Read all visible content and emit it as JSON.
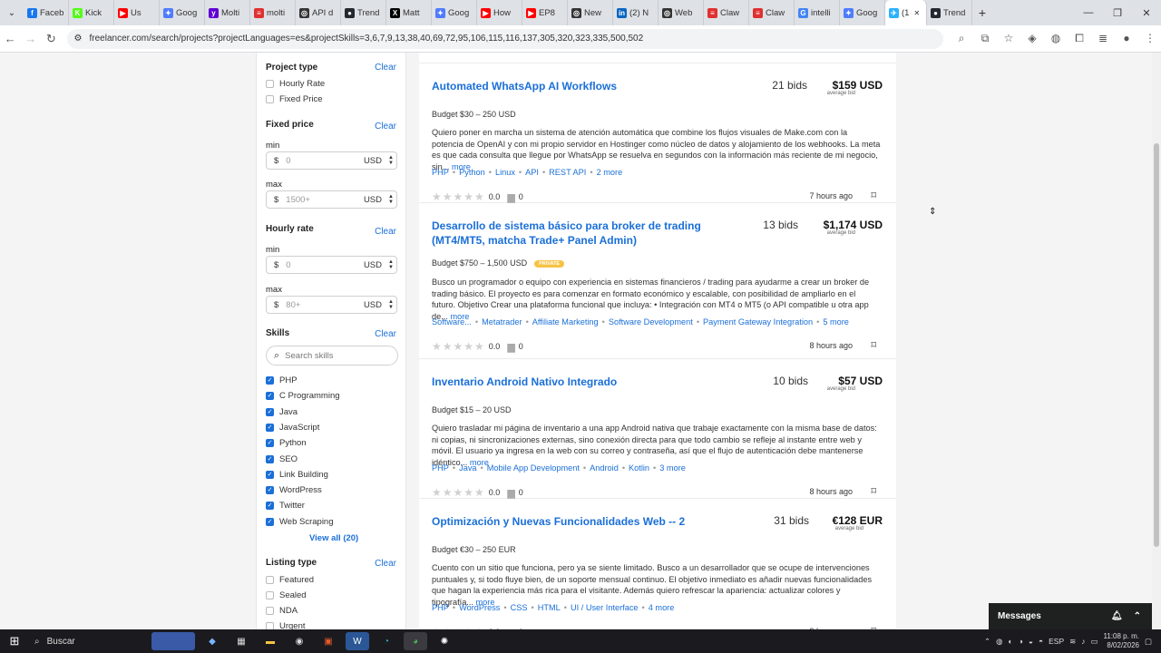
{
  "browser": {
    "tabs": [
      {
        "label": "Faceb",
        "icon": "facebook-icon",
        "color": "#1877f2",
        "glyph": "f"
      },
      {
        "label": "Kick",
        "icon": "kick-icon",
        "color": "#53fc18",
        "glyph": "K"
      },
      {
        "label": "Us",
        "icon": "youtube-icon",
        "color": "#ff0000",
        "glyph": "▶"
      },
      {
        "label": "Goog",
        "icon": "gemini-icon",
        "color": "#4f7cff",
        "glyph": "✦"
      },
      {
        "label": "Molti",
        "icon": "yahoo-icon",
        "color": "#6001d2",
        "glyph": "y"
      },
      {
        "label": "molti",
        "icon": "doc-icon",
        "color": "#e03030",
        "glyph": "≡"
      },
      {
        "label": "API d",
        "icon": "openai-icon",
        "color": "#333333",
        "glyph": "◎"
      },
      {
        "label": "Trend",
        "icon": "github-icon",
        "color": "#24292f",
        "glyph": "●"
      },
      {
        "label": "Matt",
        "icon": "x-icon",
        "color": "#000000",
        "glyph": "X"
      },
      {
        "label": "Goog",
        "icon": "gemini-icon",
        "color": "#4f7cff",
        "glyph": "✦"
      },
      {
        "label": "How",
        "icon": "youtube-icon",
        "color": "#ff0000",
        "glyph": "▶"
      },
      {
        "label": "EP8",
        "icon": "youtube-icon",
        "color": "#ff0000",
        "glyph": "▶"
      },
      {
        "label": "New",
        "icon": "openai-icon",
        "color": "#333333",
        "glyph": "◎"
      },
      {
        "label": "(2) N",
        "icon": "linkedin-icon",
        "color": "#0a66c2",
        "glyph": "in"
      },
      {
        "label": "Web",
        "icon": "openai-icon",
        "color": "#333333",
        "glyph": "◎"
      },
      {
        "label": "Claw",
        "icon": "doc-icon",
        "color": "#e03030",
        "glyph": "≡"
      },
      {
        "label": "Claw",
        "icon": "doc-icon",
        "color": "#e03030",
        "glyph": "≡"
      },
      {
        "label": "intelli",
        "icon": "google-icon",
        "color": "#4285f4",
        "glyph": "G"
      },
      {
        "label": "Goog",
        "icon": "gemini-icon",
        "color": "#4f7cff",
        "glyph": "✦"
      },
      {
        "label": "(1",
        "icon": "freelancer-icon",
        "color": "#29b2fe",
        "glyph": "✈",
        "active": true
      },
      {
        "label": "Trend",
        "icon": "github-icon",
        "color": "#24292f",
        "glyph": "●"
      }
    ],
    "url": "freelancer.com/search/projects?projectLanguages=es&projectSkills=3,6,7,9,13,38,40,69,72,95,106,115,116,137,305,320,323,335,500,502"
  },
  "sidebar": {
    "project_type": {
      "title": "Project type",
      "clear": "Clear",
      "options": [
        {
          "label": "Hourly Rate",
          "checked": false
        },
        {
          "label": "Fixed Price",
          "checked": false
        }
      ]
    },
    "fixed_price": {
      "title": "Fixed price",
      "clear": "Clear",
      "min_label": "min",
      "max_label": "max",
      "min_placeholder": "0",
      "max_placeholder": "1500+",
      "currency_symbol": "$",
      "currency": "USD"
    },
    "hourly_rate": {
      "title": "Hourly rate",
      "clear": "Clear",
      "min_label": "min",
      "max_label": "max",
      "min_placeholder": "0",
      "max_placeholder": "80+",
      "currency_symbol": "$",
      "currency": "USD"
    },
    "skills": {
      "title": "Skills",
      "clear": "Clear",
      "search_placeholder": "Search skills",
      "items": [
        {
          "label": "PHP",
          "checked": true
        },
        {
          "label": "C Programming",
          "checked": true
        },
        {
          "label": "Java",
          "checked": true
        },
        {
          "label": "JavaScript",
          "checked": true
        },
        {
          "label": "Python",
          "checked": true
        },
        {
          "label": "SEO",
          "checked": true
        },
        {
          "label": "Link Building",
          "checked": true
        },
        {
          "label": "WordPress",
          "checked": true
        },
        {
          "label": "Twitter",
          "checked": true
        },
        {
          "label": "Web Scraping",
          "checked": true
        }
      ],
      "view_all": "View all (20)"
    },
    "listing_type": {
      "title": "Listing type",
      "clear": "Clear",
      "options": [
        {
          "label": "Featured",
          "checked": false
        },
        {
          "label": "Sealed",
          "checked": false
        },
        {
          "label": "NDA",
          "checked": false
        },
        {
          "label": "Urgent",
          "checked": false
        }
      ]
    }
  },
  "projects": [
    {
      "title": "Automated WhatsApp AI Workflows",
      "bids": "21 bids",
      "price": "$159 USD",
      "price_note": "average bid",
      "budget": "Budget $30 – 250 USD",
      "private": "",
      "description": "Quiero poner en marcha un sistema de atención automática que combine los flujos visuales de Make.com con la potencia de OpenAI y con mi propio servidor en Hostinger como núcleo de datos y alojamiento de los webhooks. La meta es que cada consulta que llegue por WhatsApp se resuelva en segundos con la información más reciente de mi negocio, sin...",
      "more": "more",
      "tags": [
        "PHP",
        "Python",
        "Linux",
        "API",
        "REST API",
        "2 more"
      ],
      "rating": "0.0",
      "reviews": "0",
      "time": "7 hours ago"
    },
    {
      "title": "Desarrollo de sistema básico para broker de trading (MT4/MT5, matcha Trade+ Panel Admin)",
      "bids": "13 bids",
      "price": "$1,174 USD",
      "price_note": "average bid",
      "budget": "Budget $750 – 1,500 USD",
      "private": "PRIVATE",
      "description": "Busco un programador o equipo con experiencia en sistemas financieros / trading para ayudarme a crear un broker de trading básico. El proyecto es para comenzar en formato económico y escalable, con posibilidad de ampliarlo en el futuro. Objetivo Crear una plataforma funcional que incluya: • Integración con MT4 o MT5 (o API compatible u otra app de...",
      "more": "more",
      "tags": [
        "Software...",
        "Metatrader",
        "Affiliate Marketing",
        "Software Development",
        "Payment Gateway Integration",
        "5 more"
      ],
      "rating": "0.0",
      "reviews": "0",
      "time": "8 hours ago"
    },
    {
      "title": "Inventario Android Nativo Integrado",
      "bids": "10 bids",
      "price": "$57 USD",
      "price_note": "average bid",
      "budget": "Budget $15 – 20 USD",
      "private": "",
      "description": "Quiero trasladar mi página de inventario a una app Android nativa que trabaje exactamente con la misma base de datos: ni copias, ni sincronizaciones externas, sino conexión directa para que todo cambio se refleje al instante entre web y móvil. El usuario ya ingresa en la web con su correo y contraseña, así que el flujo de autenticación debe mantenerse idéntico...",
      "more": "more",
      "tags": [
        "PHP",
        "Java",
        "Mobile App Development",
        "Android",
        "Kotlin",
        "3 more"
      ],
      "rating": "0.0",
      "reviews": "0",
      "time": "8 hours ago"
    },
    {
      "title": "Optimización y Nuevas Funcionalidades Web -- 2",
      "bids": "31 bids",
      "price": "€128 EUR",
      "price_note": "average bid",
      "budget": "Budget €30 – 250 EUR",
      "private": "",
      "description": "Cuento con un sitio que funciona, pero ya se siente limitado. Busco a un desarrollador que se ocupe de intervenciones puntuales y, si todo fluye bien, de un soporte mensual continuo. El objetivo inmediato es añadir nuevas funcionalidades que hagan la experiencia más rica para el visitante. Además quiero refrescar la apariencia: actualizar colores y tipografía...",
      "more": "more",
      "tags": [
        "PHP",
        "WordPress",
        "CSS",
        "HTML",
        "UI / User Interface",
        "4 more"
      ],
      "rating": "0.0",
      "reviews": "0",
      "time": "9 hours ago"
    }
  ],
  "messages_panel": {
    "label": "Messages"
  },
  "taskbar": {
    "search_label": "Buscar",
    "language": "ESP",
    "time": "11:08 p. m.",
    "date": "8/02/2026"
  }
}
